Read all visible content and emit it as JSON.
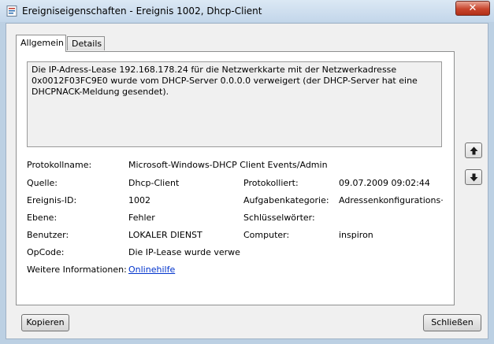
{
  "window": {
    "title": "Ereigniseigenschaften - Ereignis 1002, Dhcp-Client",
    "close_symbol": "✕"
  },
  "tabs": [
    {
      "label": "Allgemein",
      "active": true
    },
    {
      "label": "Details",
      "active": false
    }
  ],
  "event": {
    "description": "Die IP-Adress-Lease 192.168.178.24 für die Netzwerkkarte mit der Netzwerkadresse 0x0012F03FC9E0 wurde vom DHCP-Server 0.0.0.0 verweigert (der DHCP-Server hat eine DHCPNACK-Meldung gesendet).",
    "fields": {
      "log_name_label": "Protokollname:",
      "log_name_value": "Microsoft-Windows-DHCP Client Events/Admin",
      "source_label": "Quelle:",
      "source_value": "Dhcp-Client",
      "logged_label": "Protokolliert:",
      "logged_value": "09.07.2009 09:02:44",
      "event_id_label": "Ereignis-ID:",
      "event_id_value": "1002",
      "task_category_label": "Aufgabenkategorie:",
      "task_category_value": "Adressenkonfigurations·",
      "level_label": "Ebene:",
      "level_value": "Fehler",
      "keywords_label": "Schlüsselwörter:",
      "keywords_value": "",
      "user_label": "Benutzer:",
      "user_value": "LOKALER DIENST",
      "computer_label": "Computer:",
      "computer_value": "inspiron",
      "opcode_label": "OpCode:",
      "opcode_value": "Die IP-Lease wurde verweige",
      "more_info_label": "Weitere Informationen:",
      "more_info_link": "Onlinehilfe"
    }
  },
  "buttons": {
    "copy": "Kopieren",
    "close": "Schließen"
  },
  "icons": {
    "title": "event-properties-icon",
    "up": "arrow-up-icon",
    "down": "arrow-down-icon"
  }
}
